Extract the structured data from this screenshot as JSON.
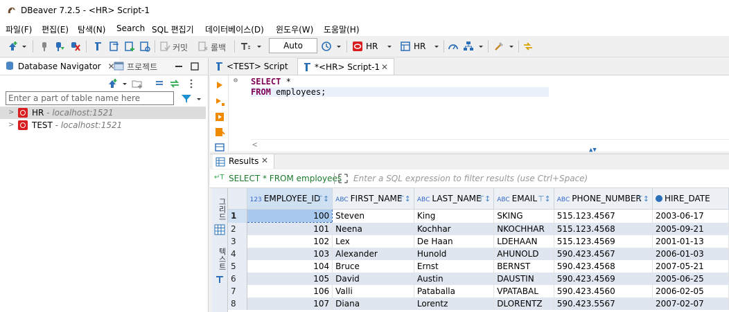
{
  "window": {
    "title": "DBeaver 7.2.5 - <HR> Script-1"
  },
  "menu": [
    "파일(F)",
    "편집(E)",
    "탐색(N)",
    "Search",
    "SQL 편집기",
    "데이터베이스(D)",
    "윈도우(W)",
    "도움말(H)"
  ],
  "toolbar": {
    "commit_label": "커밋",
    "rollback_label": "롤백",
    "tx_mode": "Auto",
    "datasource": "HR",
    "schema": "HR"
  },
  "navigator": {
    "tab_label": "Database Navigator",
    "projects_tab_label": "프로젝트",
    "filter_placeholder": "Enter a part of table name here",
    "connections": [
      {
        "name": "HR",
        "host": " - localhost:1521"
      },
      {
        "name": "TEST",
        "host": " - localhost:1521"
      }
    ]
  },
  "editor": {
    "tabs": [
      "<TEST> Script",
      "*<HR> Script-1"
    ],
    "line1_kw": "SELECT",
    "line1_rest": " *",
    "line2_kw": "FROM",
    "line2_rest": " employees;"
  },
  "results": {
    "tab_label": "Results",
    "query_label": "SELECT * FROM employees",
    "filter_placeholder": "Enter a SQL expression to filter results (use Ctrl+Space)",
    "side_tab_grid": "그리드",
    "side_tab_text": "텍스트",
    "columns": [
      {
        "type": "123",
        "name": "EMPLOYEE_ID"
      },
      {
        "type": "ABC",
        "name": "FIRST_NAME"
      },
      {
        "type": "ABC",
        "name": "LAST_NAME"
      },
      {
        "type": "ABC",
        "name": "EMAIL"
      },
      {
        "type": "ABC",
        "name": "PHONE_NUMBER"
      },
      {
        "type": "",
        "name": "HIRE_DATE"
      }
    ],
    "rows": [
      [
        "1",
        "100",
        "Steven",
        "King",
        "SKING",
        "515.123.4567",
        "2003-06-17"
      ],
      [
        "2",
        "101",
        "Neena",
        "Kochhar",
        "NKOCHHAR",
        "515.123.4568",
        "2005-09-21"
      ],
      [
        "3",
        "102",
        "Lex",
        "De Haan",
        "LDEHAAN",
        "515.123.4569",
        "2001-01-13"
      ],
      [
        "4",
        "103",
        "Alexander",
        "Hunold",
        "AHUNOLD",
        "590.423.4567",
        "2006-01-03"
      ],
      [
        "5",
        "104",
        "Bruce",
        "Ernst",
        "BERNST",
        "590.423.4568",
        "2007-05-21"
      ],
      [
        "6",
        "105",
        "David",
        "Austin",
        "DAUSTIN",
        "590.423.4569",
        "2005-06-25"
      ],
      [
        "7",
        "106",
        "Valli",
        "Pataballa",
        "VPATABAL",
        "590.423.4560",
        "2006-02-05"
      ],
      [
        "8",
        "107",
        "Diana",
        "Lorentz",
        "DLORENTZ",
        "590.423.5567",
        "2007-02-07"
      ]
    ]
  }
}
